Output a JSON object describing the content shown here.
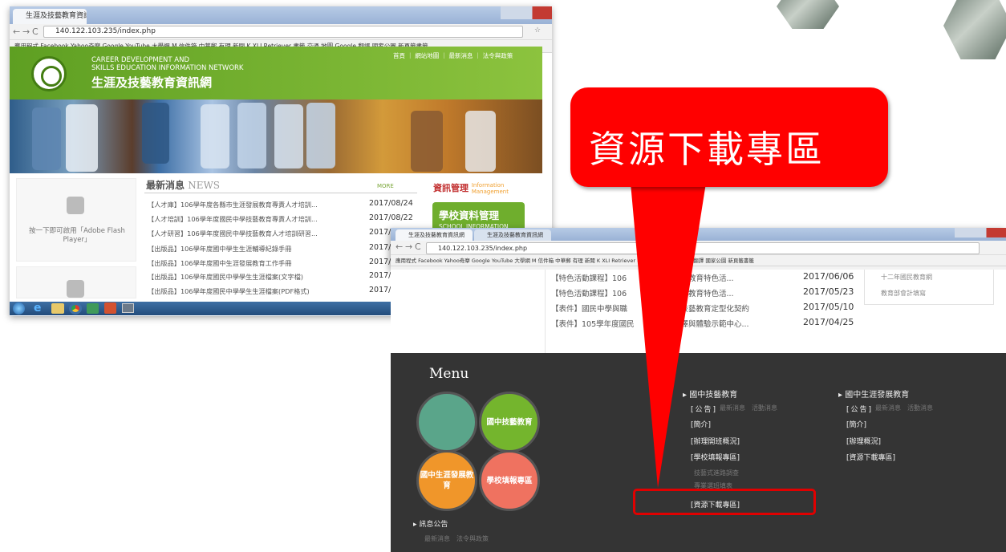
{
  "screenshot1": {
    "tab_title": "生涯及技藝教育資訊網",
    "address": "140.122.103.235/index.php",
    "bookmarks": "應用程式  Facebook  Yahoo奇摩  Google  YouTube  大學網 M 信件箱  中華郵 有理  新聞 K XLI Retriever  書籤  交通  地圖  Google 翻譯  國家公園  新頁籤書籤",
    "site_title_en_1": "CAREER DEVELOPMENT AND",
    "site_title_en_2": "SKILLS EDUCATION INFORMATION NETWORK",
    "site_title_zh": "生涯及技藝教育資訊網",
    "topnav": "首頁 ｜ 網站地圖 ｜ 最新消息 ｜ 法令與政策",
    "flash_text": "按一下即可啟用「Adobe Flash Player」",
    "news_title": "最新消息",
    "news_title_en": "NEWS",
    "news_more": "MORE",
    "news": [
      {
        "text": "【人才庫】106學年度各縣市生涯發展教育專責人才培訓...",
        "date": "2017/08/24"
      },
      {
        "text": "【人才培訓】106學年度國民中學技藝教育專責人才培訓...",
        "date": "2017/08/22"
      },
      {
        "text": "【人才研習】106學年度國民中學技藝教育人才培訓研習...",
        "date": "2017/0"
      },
      {
        "text": "【出版品】106學年度國中學生生涯輔導紀錄手冊",
        "date": "2017/"
      },
      {
        "text": "【出版品】106學年度國中生涯發展教育工作手冊",
        "date": "2017/"
      },
      {
        "text": "【出版品】106學年度國民中學學生生涯檔案(文字檔)",
        "date": "2017/"
      },
      {
        "text": "【出版品】106學年度國民中學學生生涯檔案(PDF格式)",
        "date": "2017/"
      }
    ],
    "info_label": "資訊管理",
    "info_label_en": "Information Management",
    "school_btn": "學校資料管理",
    "school_btn_en": "SCHOOL INFORMATION"
  },
  "screenshot2": {
    "tab_title": "生涯及技藝教育資訊網",
    "tab2_title": "生涯及技藝教育資訊網",
    "address": "140.122.103.235/index.php",
    "bookmarks": "應用程式  Facebook  Yahoo奇摩  Google  YouTube  大學網 M 信件箱  中華郵 有理  新聞 K XLI Retriever  書籤  交通  地圖  Google 翻譯  國家公園  新頁籤書籤",
    "news": [
      {
        "text": "【特色活動課程】106",
        "text2": "發展教育特色活...",
        "date": "2017/06/06"
      },
      {
        "text": "【特色活動課程】106",
        "text2": "發展教育特色活...",
        "date": "2017/05/23"
      },
      {
        "text": "【表件】國民中學與職",
        "text2": "課技藝教育定型化契約",
        "date": "2017/05/10"
      },
      {
        "text": "【表件】105學年度國民",
        "text2": "選擇與體驗示範中心...",
        "date": "2017/04/25"
      }
    ],
    "side_links": [
      "十二年國民教育網",
      "教育部會計填寫"
    ],
    "menu_title": "Menu",
    "circles": [
      {
        "label": "",
        "color": "#5aa58a"
      },
      {
        "label": "國中技藝教育",
        "color": "#74b52d"
      },
      {
        "label": "國中生涯發展教育",
        "color": "#f0962a"
      },
      {
        "label": "學校填報專區",
        "color": "#ef7260"
      }
    ],
    "col1_head": "國中技藝教育",
    "col1_announce": "[公告]",
    "col1_announce_sub": "最新消息　活動消息",
    "col1_links": [
      "[簡介]",
      "[辦理開班概況]",
      "[學校填報專區]"
    ],
    "col1_sub": [
      "技藝式進路調查",
      "專業選班填表"
    ],
    "col1_highlight": "[資源下載專區]",
    "col2_head": "國中生涯發展教育",
    "col2_announce": "[公告]",
    "col2_announce_sub": "最新消息　活動消息",
    "col2_links": [
      "[簡介]",
      "[辦理概況]",
      "[資源下載專區]"
    ],
    "bottom_head": "訊息公告",
    "bottom_sub": "最新消息　法令與政策"
  },
  "callout": {
    "text": "資源下載專區",
    "color": "#ff0000"
  }
}
